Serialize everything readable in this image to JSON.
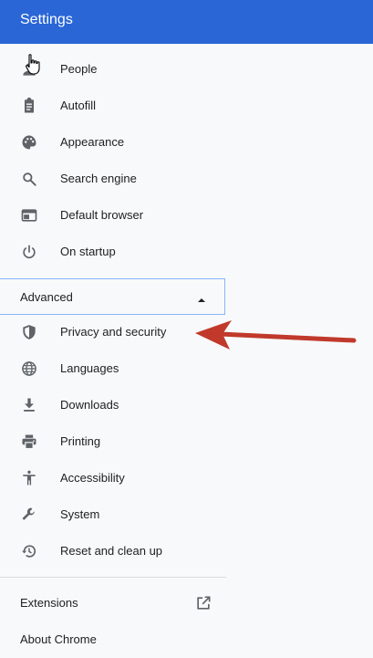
{
  "header": {
    "title": "Settings"
  },
  "menu": {
    "items": [
      {
        "label": "People",
        "icon": "person-icon"
      },
      {
        "label": "Autofill",
        "icon": "clipboard-icon"
      },
      {
        "label": "Appearance",
        "icon": "palette-icon"
      },
      {
        "label": "Search engine",
        "icon": "search-icon"
      },
      {
        "label": "Default browser",
        "icon": "browser-icon"
      },
      {
        "label": "On startup",
        "icon": "power-icon"
      }
    ],
    "advanced": {
      "label": "Advanced",
      "state": "expanded"
    },
    "advanced_items": [
      {
        "label": "Privacy and security",
        "icon": "shield-icon"
      },
      {
        "label": "Languages",
        "icon": "globe-icon"
      },
      {
        "label": "Downloads",
        "icon": "download-icon"
      },
      {
        "label": "Printing",
        "icon": "printer-icon"
      },
      {
        "label": "Accessibility",
        "icon": "accessibility-icon"
      },
      {
        "label": "System",
        "icon": "wrench-icon"
      },
      {
        "label": "Reset and clean up",
        "icon": "history-icon"
      }
    ],
    "footer": [
      {
        "label": "Extensions",
        "icon": "open-in-new-icon"
      },
      {
        "label": "About Chrome"
      }
    ]
  },
  "colors": {
    "header_bg": "#2a66d6",
    "sidebar_bg": "#f8f9fa",
    "icon": "#5f6368",
    "annotation_arrow": "#c0392b"
  }
}
